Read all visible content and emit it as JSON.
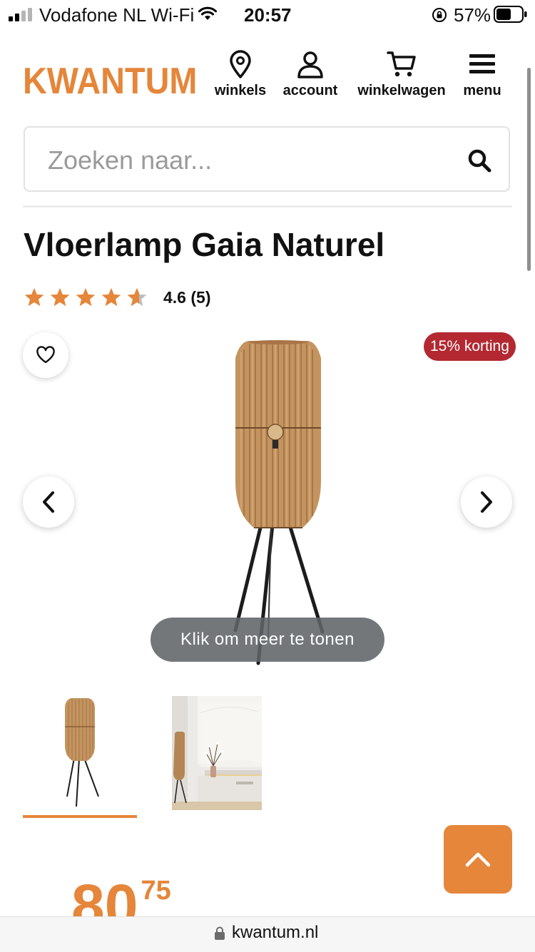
{
  "status_bar": {
    "carrier": "Vodafone NL Wi-Fi",
    "time": "20:57",
    "battery": "57%",
    "icons": [
      "signal-icon",
      "wifi-icon",
      "orientation-lock-icon",
      "battery-icon"
    ]
  },
  "header": {
    "logo": "KWANTUM",
    "nav": [
      {
        "label": "winkels",
        "icon": "location-pin-icon"
      },
      {
        "label": "account",
        "icon": "user-icon"
      },
      {
        "label": "winkelwagen",
        "icon": "cart-icon"
      },
      {
        "label": "menu",
        "icon": "hamburger-icon"
      }
    ]
  },
  "search": {
    "placeholder": "Zoeken naar...",
    "value": ""
  },
  "product": {
    "title": "Vloerlamp Gaia Naturel",
    "rating_text": "4.6 (5)",
    "rating_value": 4.6,
    "rating_max": 5,
    "discount": "15% korting",
    "more_label": "Klik om meer te tonen",
    "thumbnail_count": 2,
    "price_integer": "80",
    "price_decimals": "75"
  },
  "browser": {
    "url": "kwantum.nl"
  },
  "colors": {
    "brand": "#e5863a",
    "badge": "#b32831"
  }
}
